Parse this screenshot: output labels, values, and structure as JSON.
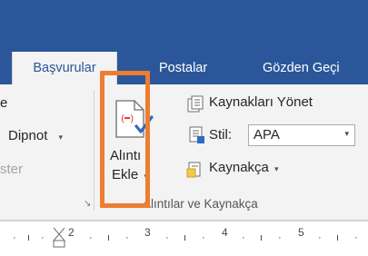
{
  "tabs": [
    {
      "label": "Başvurular",
      "active": true
    },
    {
      "label": "Postalar",
      "active": false
    },
    {
      "label": "Gözden Geçi",
      "active": false
    }
  ],
  "ribbon": {
    "left_partial": {
      "line1": "e",
      "dipnot": "Dipnot",
      "dipnot_caret": "▾",
      "disabled": "ster"
    },
    "insert_citation": {
      "line1": "Alıntı",
      "line2": "Ekle",
      "caret": "▾"
    },
    "manage_sources": "Kaynakları Yönet",
    "style_label": "Stil:",
    "style_value": "APA",
    "style_caret": "▾",
    "bibliography": "Kaynakça",
    "bibliography_caret": "▾",
    "group_label": "Alıntılar ve Kaynakça",
    "launcher_glyph": "↘"
  },
  "ruler": {
    "numbers": [
      "2",
      "3",
      "4",
      "5"
    ]
  },
  "colors": {
    "ribbon_blue": "#2b579a",
    "highlight": "#ed7d31",
    "citation_red": "#e03c31",
    "check_blue": "#2b6cc4"
  }
}
